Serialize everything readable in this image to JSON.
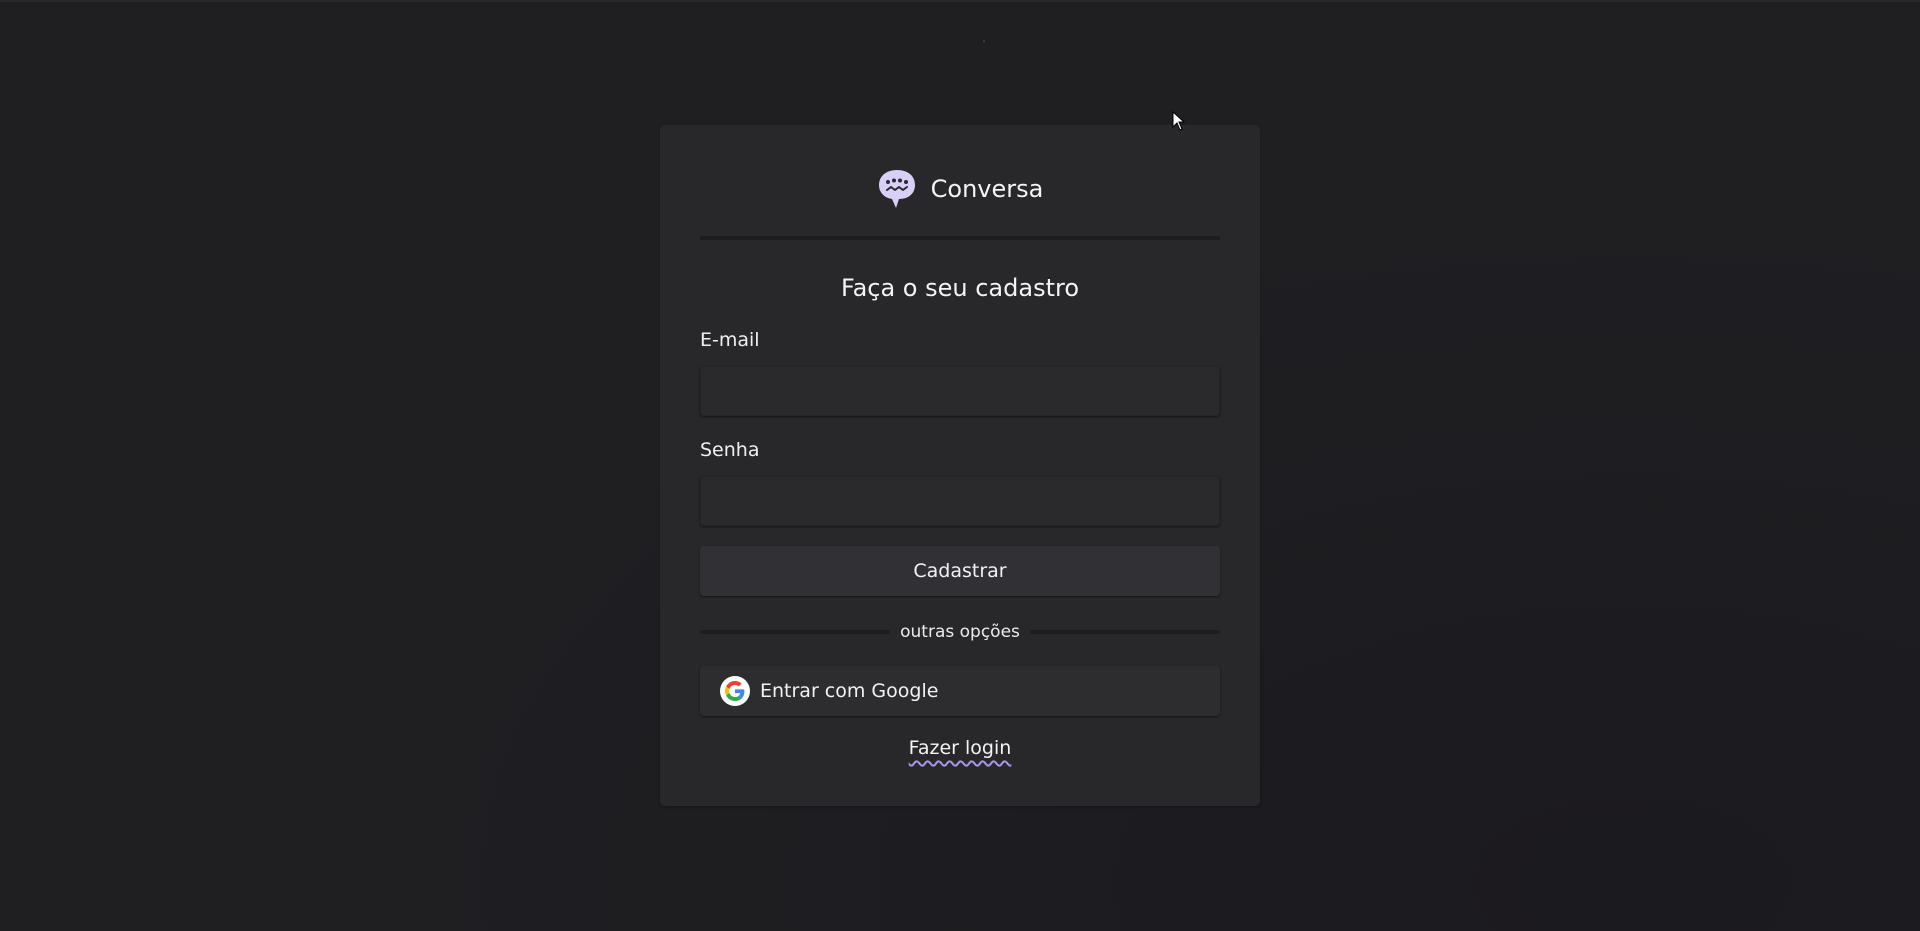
{
  "app": {
    "brand_name": "Conversa",
    "logo_icon": "chat-bubble-icon",
    "accent_color": "#a996e6"
  },
  "form": {
    "title": "Faça o seu cadastro",
    "email_label": "E-mail",
    "email_value": "",
    "password_label": "Senha",
    "password_value": "",
    "submit_label": "Cadastrar",
    "divider_text": "outras opções",
    "google_label": "Entrar com Google",
    "google_icon": "google-icon",
    "login_link": "Fazer login"
  }
}
